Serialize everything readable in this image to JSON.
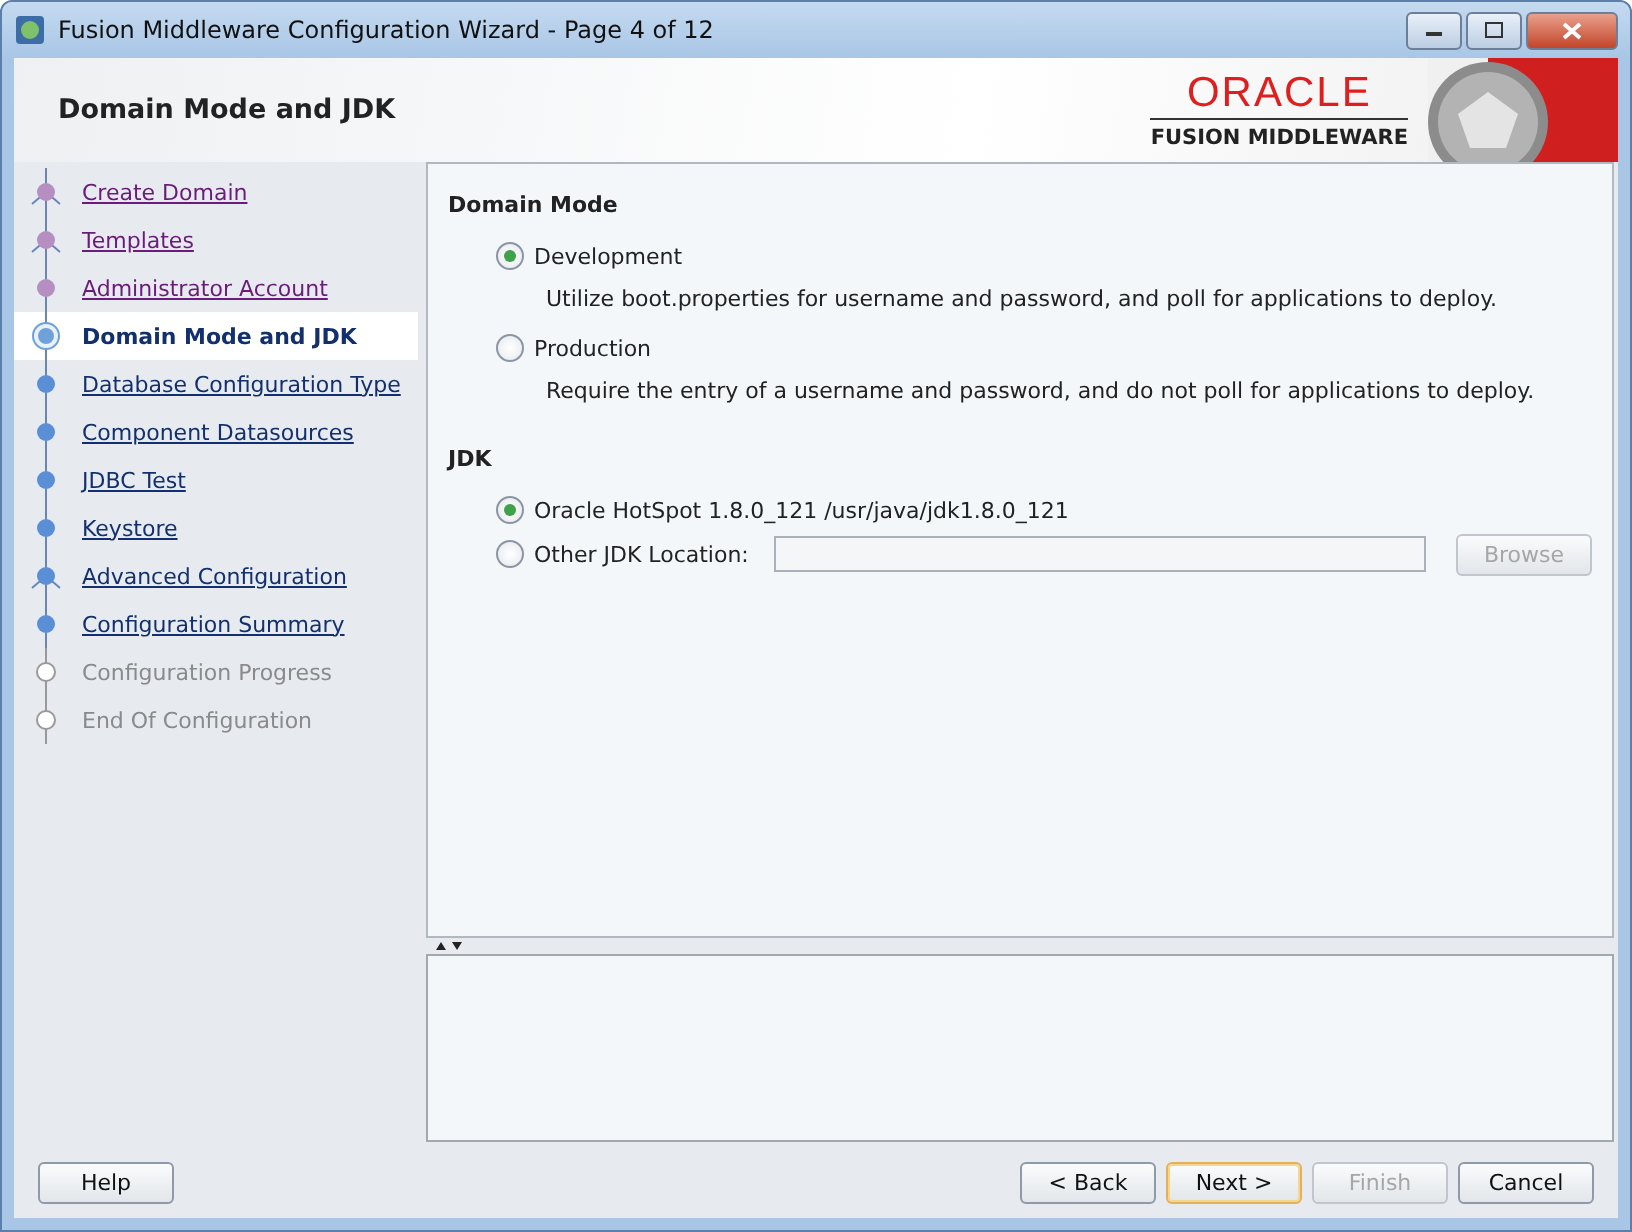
{
  "window": {
    "title": "Fusion Middleware Configuration Wizard - Page 4 of 12"
  },
  "header": {
    "title": "Domain Mode and JDK",
    "brand": "ORACLE",
    "product": "FUSION MIDDLEWARE"
  },
  "steps": [
    {
      "label": "Create Domain",
      "selected": false,
      "visited": true,
      "disabled": false,
      "branch": true
    },
    {
      "label": "Templates",
      "selected": false,
      "visited": true,
      "disabled": false,
      "branch": true
    },
    {
      "label": "Administrator Account",
      "selected": false,
      "visited": true,
      "disabled": false,
      "branch": false
    },
    {
      "label": "Domain Mode and JDK",
      "selected": true,
      "visited": false,
      "disabled": false,
      "branch": false
    },
    {
      "label": "Database Configuration Type",
      "selected": false,
      "visited": false,
      "disabled": false,
      "branch": false
    },
    {
      "label": "Component Datasources",
      "selected": false,
      "visited": false,
      "disabled": false,
      "branch": false
    },
    {
      "label": "JDBC Test",
      "selected": false,
      "visited": false,
      "disabled": false,
      "branch": false
    },
    {
      "label": "Keystore",
      "selected": false,
      "visited": false,
      "disabled": false,
      "branch": false
    },
    {
      "label": "Advanced Configuration",
      "selected": false,
      "visited": false,
      "disabled": false,
      "branch": true
    },
    {
      "label": "Configuration Summary",
      "selected": false,
      "visited": false,
      "disabled": false,
      "branch": false
    },
    {
      "label": "Configuration Progress",
      "selected": false,
      "visited": false,
      "disabled": true,
      "branch": false
    },
    {
      "label": "End Of Configuration",
      "selected": false,
      "visited": false,
      "disabled": true,
      "branch": false
    }
  ],
  "domain_mode": {
    "heading": "Domain Mode",
    "options": [
      {
        "label": "Development",
        "description": "Utilize boot.properties for username and password, and poll for applications to deploy.",
        "selected": true
      },
      {
        "label": "Production",
        "description": "Require the entry of a username and password, and do not poll for applications to deploy.",
        "selected": false
      }
    ]
  },
  "jdk": {
    "heading": "JDK",
    "options": [
      {
        "label": "Oracle HotSpot 1.8.0_121 /usr/java/jdk1.8.0_121",
        "kind": "plain",
        "selected": true
      },
      {
        "label": "Other JDK Location:",
        "kind": "location",
        "selected": false
      }
    ],
    "browse": {
      "label": "Browse",
      "disabled": true
    }
  },
  "buttons": [
    {
      "label": "Help",
      "disabled": false,
      "default": false
    },
    {
      "label": "< Back",
      "disabled": false,
      "default": false
    },
    {
      "label": "Next >",
      "disabled": false,
      "default": true
    },
    {
      "label": "Finish",
      "disabled": true,
      "default": false
    },
    {
      "label": "Cancel",
      "disabled": false,
      "default": false
    }
  ]
}
